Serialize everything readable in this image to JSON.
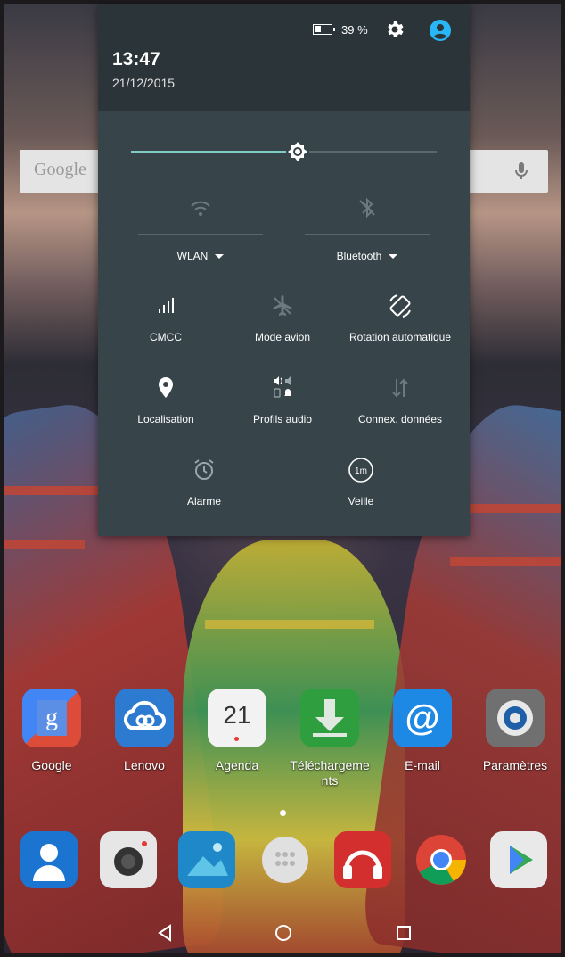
{
  "status": {
    "time": "13:47",
    "date": "21/12/2015",
    "battery_percent": "39 %",
    "battery_level": 0.39
  },
  "brightness": {
    "level": 0.5
  },
  "quick_settings": {
    "wifi": {
      "label": "WLAN",
      "icon": "wifi-icon"
    },
    "bluetooth": {
      "label": "Bluetooth",
      "icon": "bluetooth-off-icon"
    },
    "tiles": [
      {
        "label": "CMCC",
        "icon": "signal-icon"
      },
      {
        "label": "Mode avion",
        "icon": "airplane-icon"
      },
      {
        "label": "Rotation automatique",
        "icon": "rotation-icon"
      },
      {
        "label": "Localisation",
        "icon": "location-pin-icon"
      },
      {
        "label": "Profils audio",
        "icon": "audio-profiles-icon"
      },
      {
        "label": "Connex. données",
        "icon": "data-arrows-icon"
      },
      {
        "label": "Alarme",
        "icon": "alarm-clock-icon"
      },
      {
        "label": "Veille",
        "icon": "sleep-timer-icon",
        "badge": "1m"
      }
    ]
  },
  "search_widget": {
    "brand": "Google"
  },
  "home_apps": [
    {
      "label": "Google",
      "icon": "google-folder-icon"
    },
    {
      "label": "Lenovo",
      "icon": "lenovo-cloud-icon"
    },
    {
      "label": "Agenda",
      "icon": "calendar-icon",
      "badge": "21"
    },
    {
      "label": "Téléchargeme nts",
      "icon": "download-icon"
    },
    {
      "label": "E-mail",
      "icon": "email-icon"
    },
    {
      "label": "Paramètres",
      "icon": "settings-app-icon"
    }
  ],
  "dock_apps": [
    "contacts-icon",
    "camera-icon",
    "gallery-icon",
    "app-drawer-icon",
    "music-icon",
    "chrome-icon",
    "play-store-icon"
  ],
  "colors": {
    "accent": "#80cbc4",
    "shade_bg": "#37444a",
    "shade_header": "#2b3438",
    "account": "#29b6f6"
  }
}
